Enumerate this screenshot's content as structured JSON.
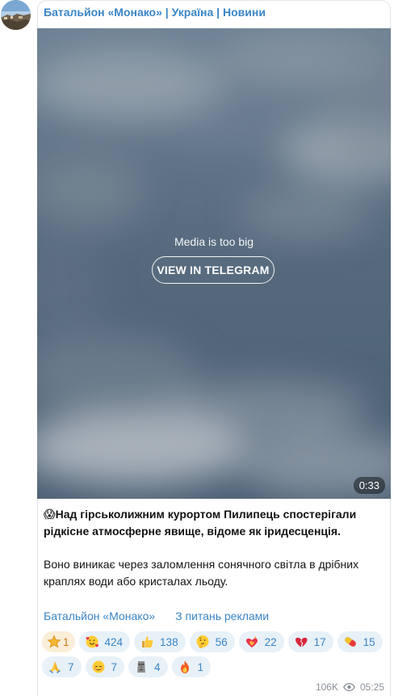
{
  "channel": {
    "title": "Батальйон «Монако» | Україна | Новини"
  },
  "media": {
    "message": "Media is too big",
    "button_label": "VIEW IN TELEGRAM",
    "duration": "0:33"
  },
  "post": {
    "lead_emoji": "😱",
    "lead_text": "Над гірськолижним курортом Пилипець спостерігали рідкісне атмосферне явище, відоме як іридесценція.",
    "body_text": "Воно виникає через заломлення сонячного світла в дрібних краплях води або кристалах льоду."
  },
  "links": {
    "channel_link": "Батальйон «Монако»",
    "ads_link": "З питань реклами"
  },
  "reactions": [
    {
      "emoji": "star",
      "count": "1"
    },
    {
      "emoji": "smiling-face-with-hearts",
      "count": "424"
    },
    {
      "emoji": "thumbs-up",
      "count": "138"
    },
    {
      "emoji": "thinking-face",
      "count": "56"
    },
    {
      "emoji": "heart-on-fire",
      "count": "22"
    },
    {
      "emoji": "broken-heart",
      "count": "17"
    },
    {
      "emoji": "pill",
      "count": "15"
    },
    {
      "emoji": "folded-hands",
      "count": "7"
    },
    {
      "emoji": "relieved-face",
      "count": "7"
    },
    {
      "emoji": "moai",
      "count": "4"
    },
    {
      "emoji": "fire",
      "count": "1"
    }
  ],
  "meta": {
    "views": "106K",
    "time": "05:25"
  }
}
